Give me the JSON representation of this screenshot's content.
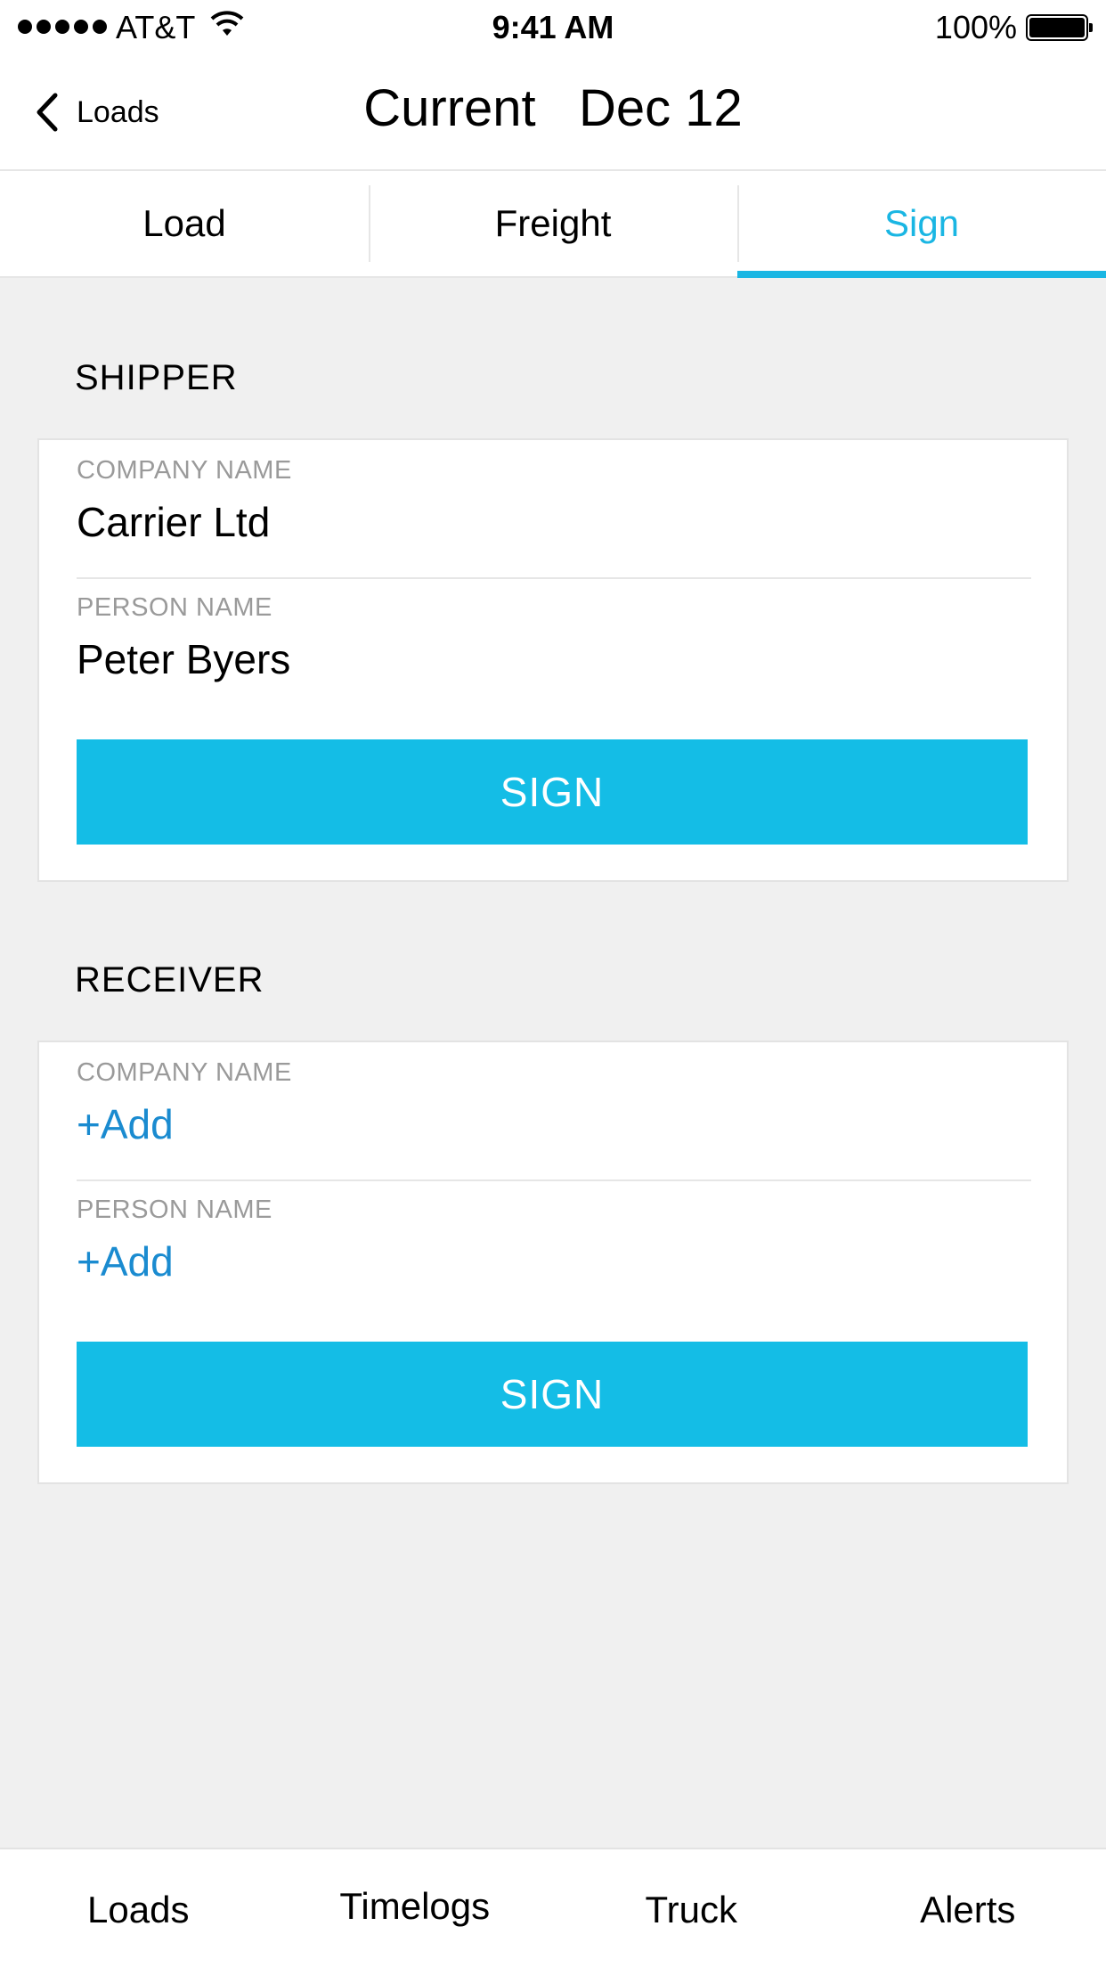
{
  "status_bar": {
    "carrier": "AT&T",
    "time": "9:41 AM",
    "battery": "100%"
  },
  "nav": {
    "back_label": "Loads",
    "title": "Current   Dec 12"
  },
  "tabs": [
    {
      "label": "Load"
    },
    {
      "label": "Freight"
    },
    {
      "label": "Sign"
    }
  ],
  "shipper": {
    "title": "SHIPPER",
    "company_label": "COMPANY NAME",
    "company_value": "Carrier Ltd",
    "person_label": "PERSON NAME",
    "person_value": "Peter Byers",
    "sign_label": "SIGN"
  },
  "receiver": {
    "title": "RECEIVER",
    "company_label": "COMPANY NAME",
    "company_value": "+Add",
    "person_label": "PERSON NAME",
    "person_value": "+Add",
    "sign_label": "SIGN"
  },
  "bottom_tabs": [
    {
      "label": "Loads"
    },
    {
      "label": "Timelogs"
    },
    {
      "label": "Truck"
    },
    {
      "label": "Alerts"
    }
  ],
  "colors": {
    "accent": "#1ab6e3",
    "button": "#14bde6",
    "link": "#1a8bd0",
    "background": "#f0f0f0"
  },
  "icons": {
    "back": "chevron-left-icon",
    "wifi": "wifi-icon",
    "battery": "battery-icon",
    "signal": "signal-dots-icon"
  }
}
